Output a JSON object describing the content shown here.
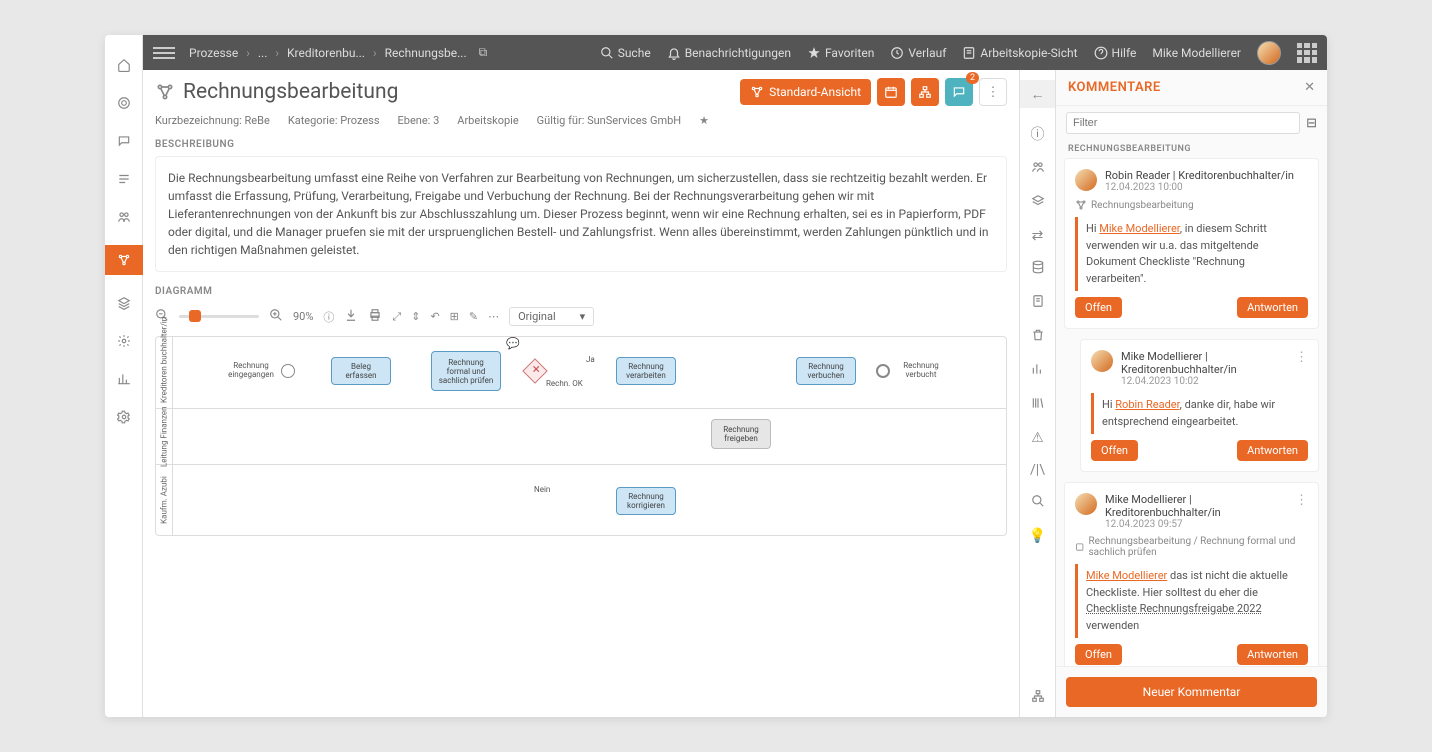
{
  "breadcrumbs": [
    "Prozesse",
    "...",
    "Kreditorenbu...",
    "Rechnungsbe..."
  ],
  "topActions": {
    "search": "Suche",
    "notifications": "Benachrichtigungen",
    "favorites": "Favoriten",
    "history": "Verlauf",
    "workcopy": "Arbeitskopie-Sicht",
    "help": "Hilfe",
    "user": "Mike Modellierer"
  },
  "page": {
    "title": "Rechnungsbearbeitung",
    "standardView": "Standard-Ansicht",
    "commentBadge": "2"
  },
  "meta": {
    "short": "Kurzbezeichnung: ReBe",
    "category": "Kategorie: Prozess",
    "level": "Ebene: 3",
    "workcopy": "Arbeitskopie",
    "validFor": "Gültig für: SunServices GmbH"
  },
  "sections": {
    "descriptionLabel": "BESCHREIBUNG",
    "diagramLabel": "DIAGRAMM",
    "description": "Die Rechnungsbearbeitung umfasst eine Reihe von Verfahren zur Bearbeitung von Rechnungen, um sicherzustellen, dass sie rechtzeitig bezahlt werden. Er umfasst die Erfassung, Prüfung, Verarbeitung, Freigabe und Verbuchung der Rechnung. Bei der Rechnungsverarbeitung gehen wir mit Lieferantenrechnungen von der Ankunft bis zur Abschlusszahlung um. Dieser Prozess beginnt, wenn wir eine Rechnung erhalten, sei es in Papierform, PDF oder digital, und die Manager pruefen sie mit der urspruenglichen Bestell- und Zahlungsfrist. Wenn alles übereinstimmt, werden Zahlungen pünktlich und in den richtigen Maßnahmen geleistet."
  },
  "diagram": {
    "zoom": "90%",
    "variant": "Original",
    "lanes": [
      "Kreditoren buchhalter/in",
      "Leitung Finanzen",
      "Kaufm. Azubi"
    ],
    "startLabel": "Rechnung eingegangen",
    "t1": "Beleg erfassen",
    "t2": "Rechnung formal und sachlich prüfen",
    "gwLabel": "Rechn. OK",
    "gwYes": "Ja",
    "gwNo": "Nein",
    "t3": "Rechnung verarbeiten",
    "t4": "Rechnung freigeben",
    "t5": "Rechnung verbuchen",
    "t6": "Rechnung korrigieren",
    "endLabel": "Rechnung verbucht"
  },
  "comments": {
    "title": "KOMMENTARE",
    "filterPlaceholder": "Filter",
    "context": "RECHNUNGSBEARBEITUNG",
    "newComment": "Neuer Kommentar",
    "statusOpen": "Offen",
    "replyLabel": "Antworten",
    "items": [
      {
        "author": "Robin Reader | Kreditorenbuchhalter/in",
        "date": "12.04.2023 10:00",
        "ref": "Rechnungsbearbeitung",
        "greeting": "Hi ",
        "mention": "Mike Modellierer",
        "body": ", in diesem Schritt verwenden wir u.a. das mitgeltende Dokument Checkliste \"Rechnung verarbeiten\"."
      },
      {
        "author": "Mike Modellierer | Kreditorenbuchhalter/in",
        "date": "12.04.2023 10:02",
        "greeting": "Hi ",
        "mention": "Robin Reader",
        "body": ", danke dir, habe wir entsprechend eingearbeitet."
      },
      {
        "author": "Mike Modellierer | Kreditorenbuchhalter/in",
        "date": "12.04.2023 09:57",
        "ref": "Rechnungsbearbeitung / Rechnung formal und sachlich prüfen",
        "mention": "Mike Modellierer",
        "body1": " das ist nicht die aktuelle Checkliste. Hier solltest du eher die ",
        "link": "Checkliste Rechnungsfreigabe 2022",
        "body2": " verwenden"
      }
    ]
  }
}
